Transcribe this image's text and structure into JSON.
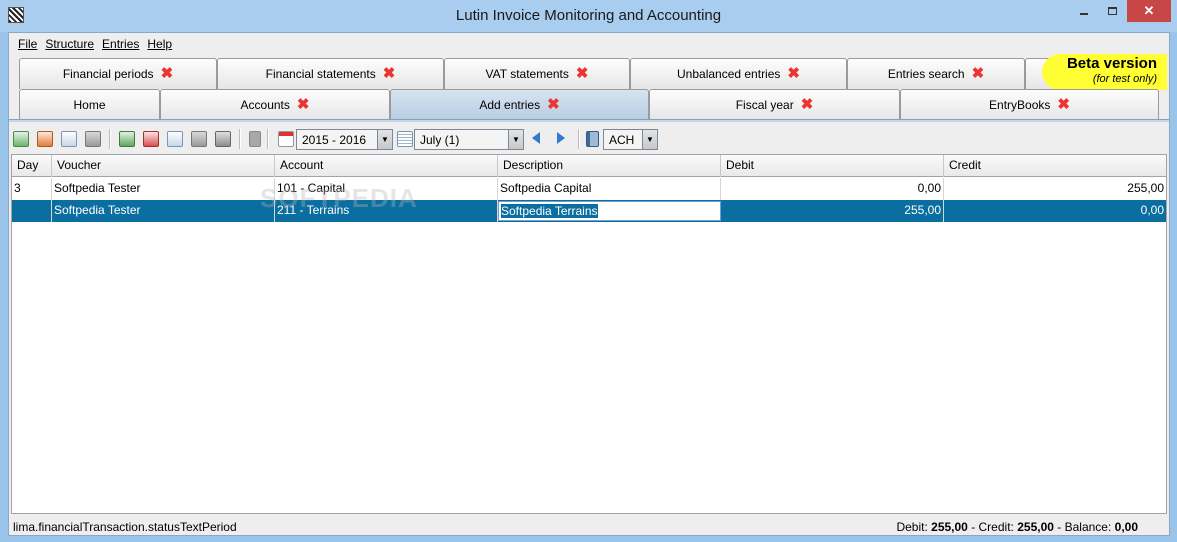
{
  "window": {
    "title": "Lutin Invoice Monitoring and Accounting"
  },
  "menu": [
    "File",
    "Structure",
    "Entries",
    "Help"
  ],
  "tabs_row1": [
    "Financial periods",
    "Financial statements",
    "VAT statements",
    "Unbalanced entries",
    "Entries search"
  ],
  "tabs_row2": [
    "Home",
    "Accounts",
    "Add entries",
    "Fiscal year",
    "EntryBooks"
  ],
  "active_tab": "Add entries",
  "beta": {
    "title": "Beta version",
    "subtitle": "(for test only)"
  },
  "toolbar": {
    "fiscal_year": "2015 - 2016",
    "period": "July (1)",
    "journal": "ACH"
  },
  "table": {
    "columns": [
      "Day",
      "Voucher",
      "Account",
      "Description",
      "Debit",
      "Credit"
    ],
    "rows": [
      {
        "day": "3",
        "voucher": "Softpedia Tester",
        "account": "101 - Capital",
        "description": "Softpedia Capital",
        "debit": "0,00",
        "credit": "255,00"
      },
      {
        "day": "",
        "voucher": "Softpedia Tester",
        "account": "211 - Terrains",
        "description": "Softpedia Terrains",
        "debit": "255,00",
        "credit": "0,00"
      }
    ]
  },
  "status": {
    "left": "lima.financialTransaction.statusTextPeriod",
    "debit_label": "Debit:",
    "debit": "255,00",
    "credit_label": "- Credit:",
    "credit": "255,00",
    "balance_label": "- Balance:",
    "balance": "0,00"
  },
  "watermark": "SOFTPEDIA",
  "colors": {
    "selection": "#0b6ea0",
    "close_mark": "#ee3333",
    "beta_bg": "#ffff33"
  }
}
